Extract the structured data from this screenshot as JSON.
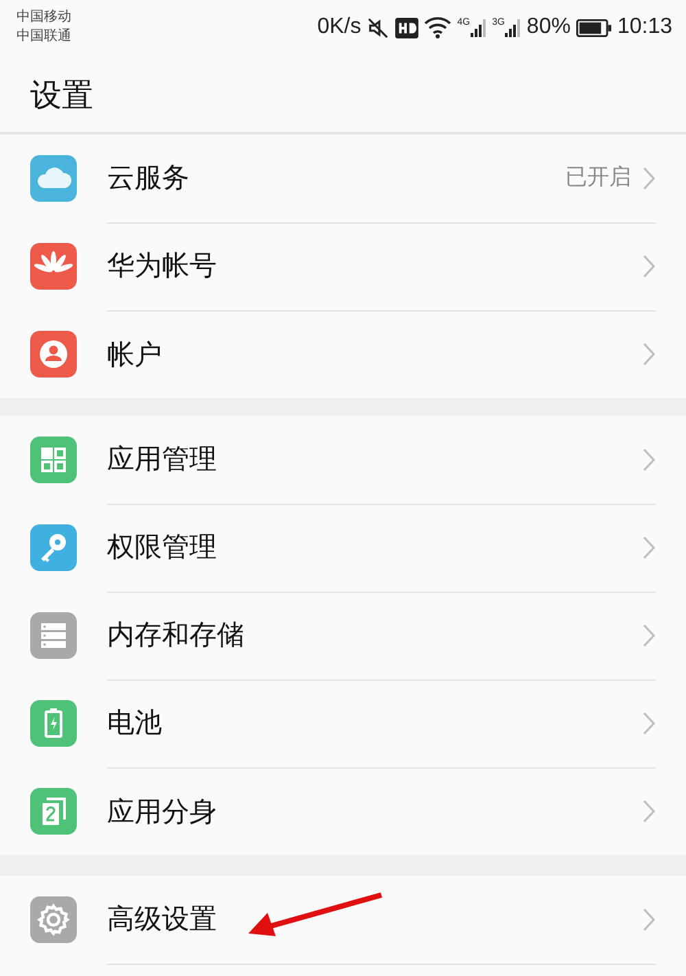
{
  "status_bar": {
    "carriers": [
      "中国移动",
      "中国联通"
    ],
    "speed": "0K/s",
    "networks": [
      "4G",
      "3G"
    ],
    "battery": "80%",
    "time": "10:13"
  },
  "title": "设置",
  "groups": [
    {
      "items": [
        {
          "label": "云服务",
          "value": "已开启"
        },
        {
          "label": "华为帐号"
        },
        {
          "label": "帐户"
        }
      ]
    },
    {
      "items": [
        {
          "label": "应用管理"
        },
        {
          "label": "权限管理"
        },
        {
          "label": "内存和存储"
        },
        {
          "label": "电池"
        },
        {
          "label": "应用分身"
        }
      ]
    },
    {
      "items": [
        {
          "label": "高级设置"
        }
      ]
    }
  ]
}
